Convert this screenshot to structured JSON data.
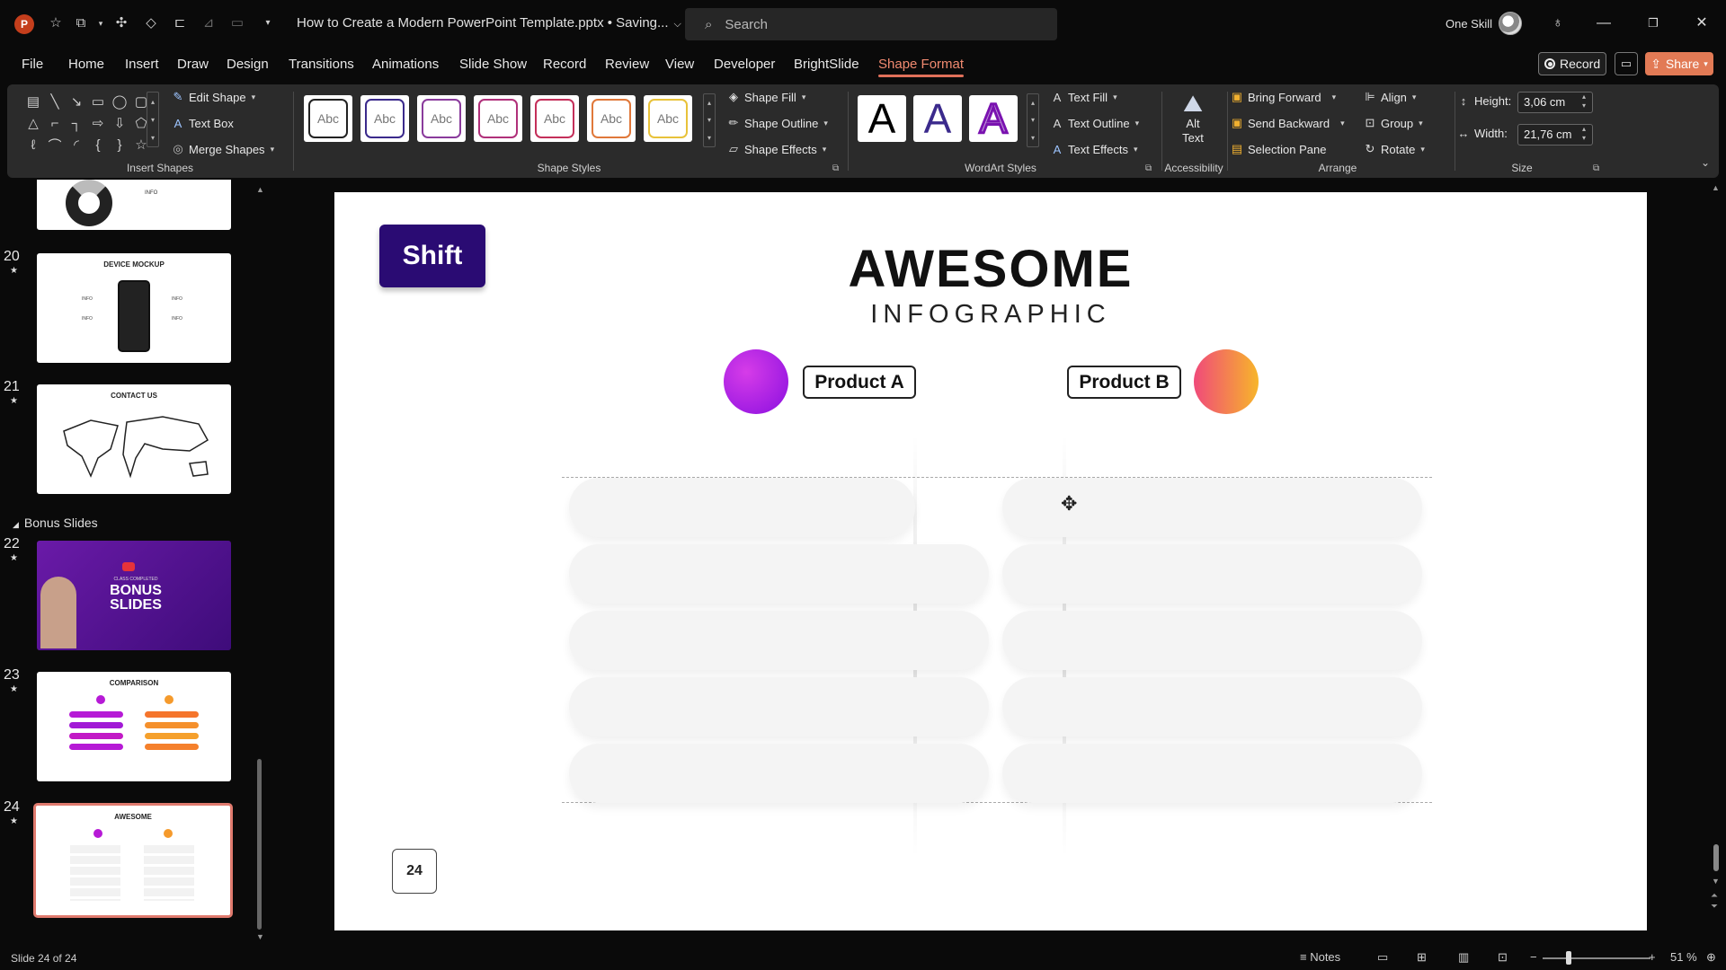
{
  "window": {
    "app_logo": "P",
    "document_title": "How to Create a Modern PowerPoint Template.pptx • Saving...",
    "search_placeholder": "Search",
    "user_name": "One Skill",
    "icons": [
      "autosave-icon",
      "save-icon",
      "undo-icon",
      "redo-icon",
      "customize-icon"
    ]
  },
  "menu": {
    "tabs": [
      "File",
      "Home",
      "Insert",
      "Draw",
      "Design",
      "Transitions",
      "Animations",
      "Slide Show",
      "Record",
      "Review",
      "View",
      "Developer",
      "BrightSlide",
      "Shape Format"
    ],
    "active_tab": "Shape Format",
    "record_label": "Record",
    "share_label": "Share"
  },
  "ribbon": {
    "insert_shapes": {
      "label": "Insert Shapes",
      "edit_shape": "Edit Shape",
      "text_box": "Text Box",
      "merge_shapes": "Merge Shapes"
    },
    "shape_styles": {
      "label": "Shape Styles",
      "thumb_text": "Abc",
      "thumb_colors": [
        "#222222",
        "#3b2a8c",
        "#8a3b9c",
        "#b0307a",
        "#c42f5a",
        "#e0783a",
        "#e8c23a"
      ],
      "shape_fill": "Shape Fill",
      "shape_outline": "Shape Outline",
      "shape_effects": "Shape Effects"
    },
    "wordart_styles": {
      "label": "WordArt Styles",
      "letter": "A",
      "text_fill": "Text Fill",
      "text_outline": "Text Outline",
      "text_effects": "Text Effects"
    },
    "accessibility": {
      "label": "Accessibility",
      "alt_text": "Alt Text"
    },
    "arrange": {
      "label": "Arrange",
      "bring_forward": "Bring Forward",
      "send_backward": "Send Backward",
      "selection_pane": "Selection Pane",
      "align": "Align",
      "group": "Group",
      "rotate": "Rotate"
    },
    "size": {
      "label": "Size",
      "height_label": "Height:",
      "height_value": "3,06 cm",
      "width_label": "Width:",
      "width_value": "21,76 cm"
    }
  },
  "sidebar": {
    "section_label": "Bonus Slides",
    "slides": [
      {
        "number": "",
        "title": "",
        "info": "INFO"
      },
      {
        "number": "20",
        "title": "DEVICE MOCKUP",
        "info": "INFO"
      },
      {
        "number": "21",
        "title": "CONTACT US"
      },
      {
        "number": "22",
        "title": "BONUS SLIDES",
        "subtitle": "CLASS COMPLETED"
      },
      {
        "number": "23",
        "title": "COMPARISON"
      },
      {
        "number": "24",
        "title": "AWESOME"
      }
    ]
  },
  "slide": {
    "logo_text": "Shift",
    "title": "AWESOME",
    "subtitle": "INFOGRAPHIC",
    "product_a": "Product A",
    "product_b": "Product B",
    "page_number": "24",
    "colors": {
      "logo_bg": "#2a0b73",
      "product_a_gradient": [
        "#c21ad6",
        "#7a0fe0"
      ],
      "product_b_gradient": [
        "#f04a7a",
        "#f7b52a"
      ]
    }
  },
  "status": {
    "slide_counter": "Slide 24 of 24",
    "notes_label": "Notes",
    "zoom": "51 %"
  }
}
